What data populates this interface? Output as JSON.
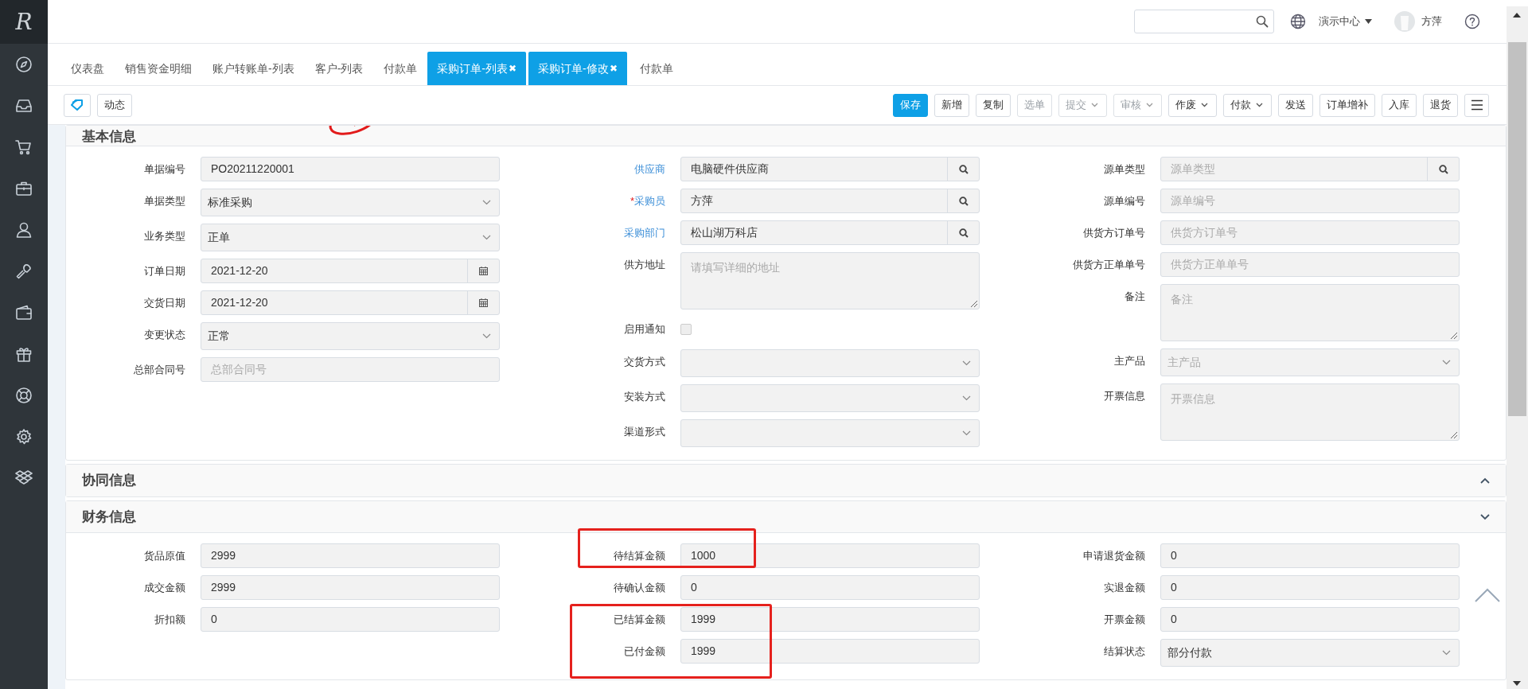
{
  "logo": "R",
  "topbar": {
    "org": "演示中心",
    "user": "方萍"
  },
  "tabs": [
    {
      "label": "仪表盘",
      "selected": false
    },
    {
      "label": "销售资金明细",
      "selected": false
    },
    {
      "label": "账户转账单-列表",
      "selected": false
    },
    {
      "label": "客户-列表",
      "selected": false
    },
    {
      "label": "付款单",
      "selected": false
    },
    {
      "label": "采购订单-列表",
      "selected": true,
      "close": "✖"
    },
    {
      "label": "采购订单-修改",
      "selected": true,
      "close": "✖"
    },
    {
      "label": "付款单",
      "selected": false
    }
  ],
  "toolbar_left": [
    {
      "kind": "icon"
    },
    {
      "kind": "text",
      "label": "动态"
    }
  ],
  "toolbar": [
    {
      "label": "保存",
      "kind": "primary",
      "disabled": false,
      "dropdown": false
    },
    {
      "label": "新增",
      "kind": "default",
      "disabled": false,
      "dropdown": false
    },
    {
      "label": "复制",
      "kind": "default",
      "disabled": false,
      "dropdown": false
    },
    {
      "label": "选单",
      "kind": "default",
      "disabled": true,
      "dropdown": false
    },
    {
      "label": "提交",
      "kind": "default",
      "disabled": true,
      "dropdown": true
    },
    {
      "label": "审核",
      "kind": "default",
      "disabled": true,
      "dropdown": true
    },
    {
      "label": "作废",
      "kind": "default",
      "disabled": false,
      "dropdown": true
    },
    {
      "label": "付款",
      "kind": "default",
      "disabled": false,
      "dropdown": true
    },
    {
      "label": "发送",
      "kind": "default",
      "disabled": false,
      "dropdown": false
    },
    {
      "label": "订单增补",
      "kind": "default",
      "disabled": false,
      "dropdown": false
    },
    {
      "label": "入库",
      "kind": "default",
      "disabled": false,
      "dropdown": false
    },
    {
      "label": "退货",
      "kind": "default",
      "disabled": false,
      "dropdown": false
    }
  ],
  "sections": [
    {
      "title": "基本信息",
      "columns": [
        [
          {
            "label": "单据编号",
            "kind": "text",
            "value": "PO20211220001"
          },
          {
            "label": "单据类型",
            "kind": "select",
            "value": "标准采购"
          },
          {
            "label": "业务类型",
            "kind": "select",
            "value": "正单"
          },
          {
            "label": "订单日期",
            "kind": "date",
            "value": "2021-12-20"
          },
          {
            "label": "交货日期",
            "kind": "date",
            "value": "2021-12-20"
          },
          {
            "label": "变更状态",
            "kind": "select",
            "value": "正常"
          },
          {
            "label": "总部合同号",
            "kind": "text",
            "placeholder": "总部合同号"
          }
        ],
        [
          {
            "label": "供应商",
            "link": true,
            "kind": "lookup",
            "value": "电脑硬件供应商"
          },
          {
            "label": "采购员",
            "required_mark": "*",
            "link": true,
            "kind": "lookup",
            "value": "方萍"
          },
          {
            "label": "采购部门",
            "link": true,
            "kind": "lookup",
            "value": "松山湖万科店"
          },
          {
            "label": "供方地址",
            "kind": "textarea",
            "placeholder": "请填写详细的地址"
          },
          {
            "label": "启用通知",
            "kind": "checkbox",
            "checked": false
          },
          {
            "label": "交货方式",
            "kind": "select"
          },
          {
            "label": "安装方式",
            "kind": "select"
          },
          {
            "label": "渠道形式",
            "kind": "select"
          }
        ],
        [
          {
            "label": "源单类型",
            "kind": "lookup",
            "placeholder": "源单类型"
          },
          {
            "label": "源单编号",
            "kind": "text",
            "placeholder": "源单编号"
          },
          {
            "label": "供货方订单号",
            "kind": "text",
            "placeholder": "供货方订单号"
          },
          {
            "label": "供货方正单单号",
            "kind": "text",
            "placeholder": "供货方正单单号"
          },
          {
            "label": "备注",
            "kind": "textarea",
            "placeholder": "备注"
          },
          {
            "label": "主产品",
            "kind": "select",
            "placeholder": "主产品"
          },
          {
            "label": "开票信息",
            "kind": "textarea",
            "placeholder": "开票信息"
          }
        ]
      ]
    },
    {
      "title": "协同信息",
      "expanded": false
    },
    {
      "title": "财务信息",
      "expanded": true,
      "columns": [
        [
          {
            "label": "货品原值",
            "kind": "text",
            "value": "2999"
          },
          {
            "label": "成交金额",
            "kind": "text",
            "value": "2999"
          },
          {
            "label": "折扣额",
            "kind": "text",
            "value": "0"
          }
        ],
        [
          {
            "label": "待结算金额",
            "kind": "text",
            "value": "1000"
          },
          {
            "label": "待确认金额",
            "kind": "text",
            "value": "0"
          },
          {
            "label": "已结算金额",
            "kind": "text",
            "value": "1999"
          },
          {
            "label": "已付金额",
            "kind": "text",
            "value": "1999"
          }
        ],
        [
          {
            "label": "申请退货金额",
            "kind": "text",
            "value": "0"
          },
          {
            "label": "实退金额",
            "kind": "text",
            "value": "0"
          },
          {
            "label": "开票金额",
            "kind": "text",
            "value": "0"
          },
          {
            "label": "结算状态",
            "kind": "select",
            "value": "部分付款"
          }
        ]
      ]
    }
  ]
}
